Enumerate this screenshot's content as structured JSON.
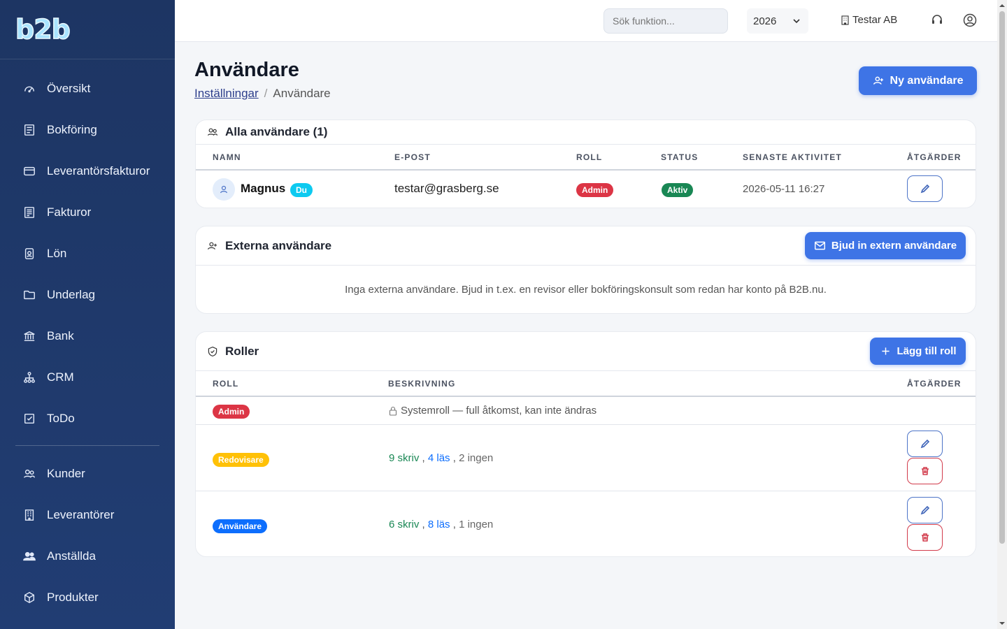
{
  "sidebar": {
    "logo_text": "b2b",
    "items": [
      {
        "label": "Översikt",
        "icon": "gauge-icon"
      },
      {
        "label": "Bokföring",
        "icon": "ledger-icon"
      },
      {
        "label": "Leverantörsfakturor",
        "icon": "credit-card-icon"
      },
      {
        "label": "Fakturor",
        "icon": "invoice-icon"
      },
      {
        "label": "Lön",
        "icon": "badge-icon"
      },
      {
        "label": "Underlag",
        "icon": "folder-icon"
      },
      {
        "label": "Bank",
        "icon": "bank-icon"
      },
      {
        "label": "CRM",
        "icon": "hierarchy-icon"
      },
      {
        "label": "ToDo",
        "icon": "checkbox-icon"
      },
      {
        "label": "Kunder",
        "icon": "people-icon"
      },
      {
        "label": "Leverantörer",
        "icon": "building-icon"
      },
      {
        "label": "Anställda",
        "icon": "team-icon"
      },
      {
        "label": "Produkter",
        "icon": "box-icon"
      }
    ]
  },
  "topbar": {
    "search_placeholder": "Sök funktion...",
    "year": "2026",
    "company": "Testar AB"
  },
  "page": {
    "title": "Användare",
    "breadcrumb_parent": "Inställningar",
    "breadcrumb_current": "Användare",
    "new_user_button": "Ny användare"
  },
  "all_users": {
    "title": "Alla användare (1)",
    "columns": [
      "NAMN",
      "E-POST",
      "ROLL",
      "STATUS",
      "SENASTE AKTIVITET",
      "ÅTGÄRDER"
    ],
    "rows": [
      {
        "name": "Magnus",
        "you_badge": "Du",
        "email": "testar@grasberg.se",
        "role": "Admin",
        "status": "Aktiv",
        "last_activity": "2026-05-11 16:27"
      }
    ]
  },
  "external_users": {
    "title": "Externa användare",
    "invite_button": "Bjud in extern användare",
    "empty_text": "Inga externa användare. Bjud in t.ex. en revisor eller bokföringskonsult som redan har konto på B2B.nu."
  },
  "roles": {
    "title": "Roller",
    "add_button": "Lägg till roll",
    "columns": [
      "ROLL",
      "BESKRIVNING",
      "ÅTGÄRDER"
    ],
    "rows": [
      {
        "role": "Admin",
        "color": "#dc3545",
        "description": "Systemroll — full åtkomst, kan inte ändras"
      },
      {
        "role": "Redovisare",
        "color": "#ffc107",
        "write": "9 skriv",
        "read": "4 läs",
        "none": "2 ingen"
      },
      {
        "role": "Användare",
        "color": "#0d6efd",
        "write": "6 skriv",
        "read": "8 läs",
        "none": "1 ingen"
      }
    ]
  },
  "colors": {
    "sidebar": "#1d3563",
    "primary": "#3e74e6",
    "admin": "#dc3545",
    "active": "#198754",
    "you": "#0dcaf0",
    "write": "#198754",
    "read": "#0d6efd"
  }
}
